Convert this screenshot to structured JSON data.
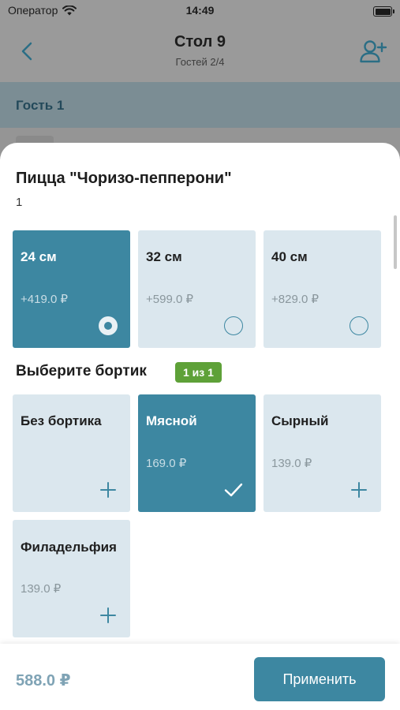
{
  "status_bar": {
    "carrier": "Оператор",
    "time": "14:49"
  },
  "header": {
    "title": "Стол 9",
    "subtitle": "Гостей 2/4"
  },
  "guest": {
    "label": "Гость 1"
  },
  "product": {
    "name": "Пицца \"Чоризо-пепперони\"",
    "quantity": "1"
  },
  "sizes": [
    {
      "label": "24 см",
      "price": "+419.0 ₽",
      "selected": true
    },
    {
      "label": "32 см",
      "price": "+599.0 ₽",
      "selected": false
    },
    {
      "label": "40 см",
      "price": "+829.0 ₽",
      "selected": false
    }
  ],
  "crust_section": {
    "title": "Выберите бортик",
    "badge": "1 из 1"
  },
  "crusts": [
    {
      "label": "Без бортика",
      "price": "",
      "selected": false
    },
    {
      "label": "Мясной",
      "price": "169.0 ₽",
      "selected": true
    },
    {
      "label": "Сырный",
      "price": "139.0 ₽",
      "selected": false
    },
    {
      "label": "Филадельфия",
      "price": "139.0 ₽",
      "selected": false
    }
  ],
  "footer": {
    "total": "588.0 ₽",
    "apply_label": "Применить"
  },
  "colors": {
    "accent": "#3d87a1",
    "card_bg": "#dbe7ee",
    "badge_green": "#5ea138"
  }
}
